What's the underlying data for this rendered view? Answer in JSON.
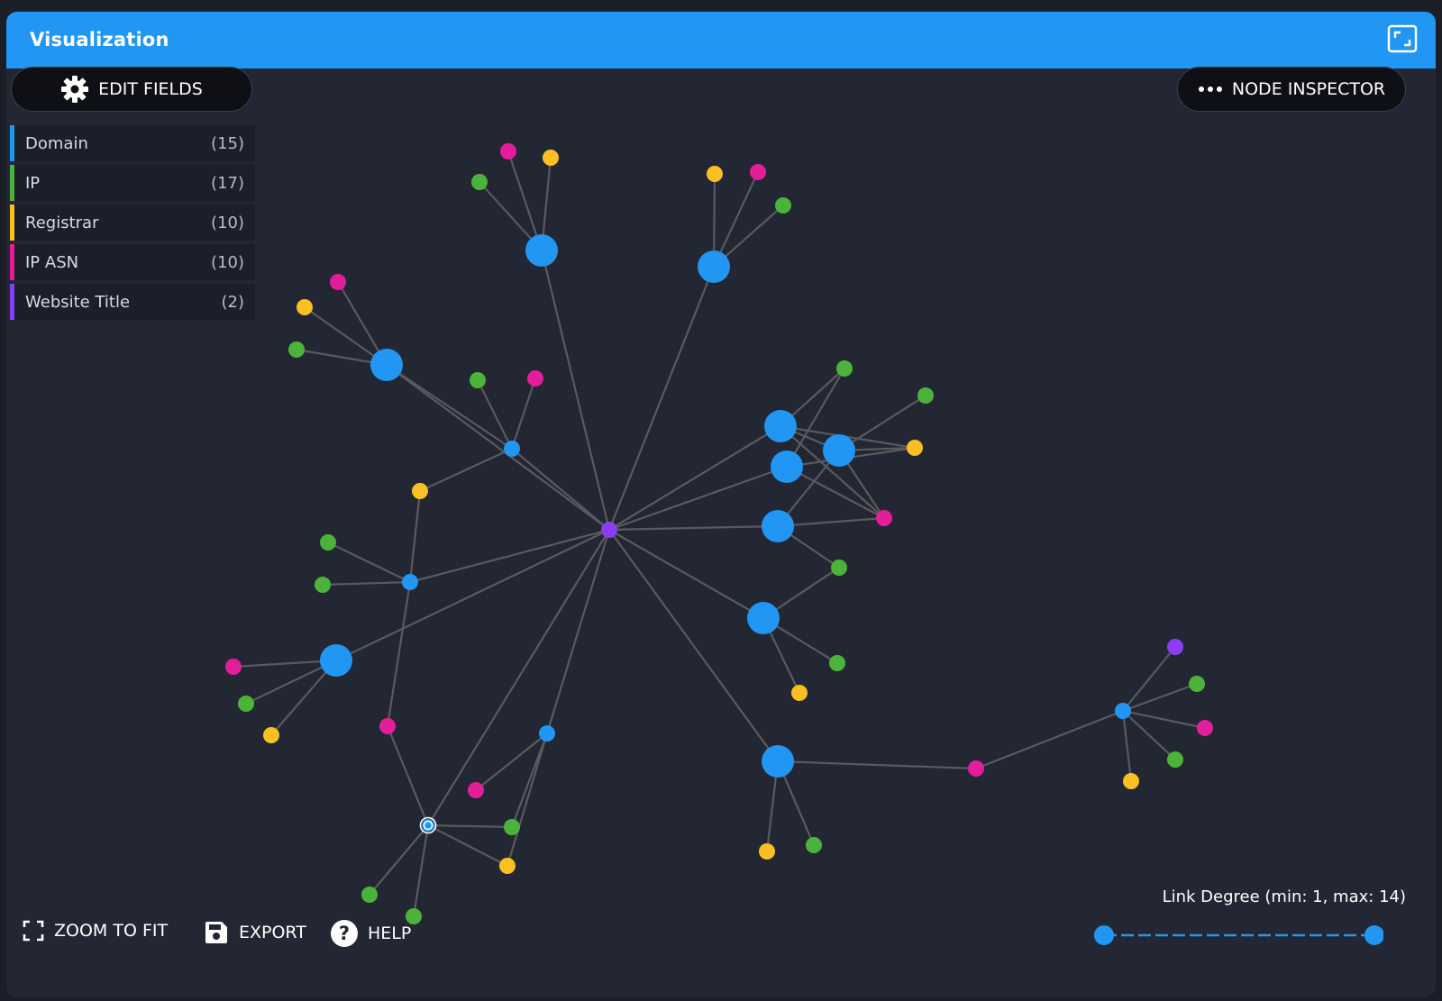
{
  "header": {
    "title": "Visualization",
    "color": "#2196f3"
  },
  "toolbar": {
    "edit_fields_label": "EDIT FIELDS",
    "node_inspector_label": "NODE INSPECTOR",
    "zoom_to_fit_label": "ZOOM TO FIT",
    "export_label": "EXPORT",
    "help_label": "HELP"
  },
  "legend": [
    {
      "label": "Domain",
      "count": "(15)",
      "color": "#2196f3"
    },
    {
      "label": "IP",
      "count": "(17)",
      "color": "#4cb33a"
    },
    {
      "label": "Registrar",
      "count": "(10)",
      "color": "#fbbf24"
    },
    {
      "label": "IP ASN",
      "count": "(10)",
      "color": "#e21e9a"
    },
    {
      "label": "Website Title",
      "count": "(2)",
      "color": "#8b3df5"
    }
  ],
  "link_degree": {
    "label": "Link Degree (min: 1, max: 14)",
    "min": 1,
    "max": 14,
    "selected_min": 1,
    "selected_max": 14
  },
  "icons": {
    "fullscreen": "fullscreen-icon",
    "settings": "gear-icon",
    "more": "more-dots-icon",
    "zoom_fit": "zoom-fit-icon",
    "export": "save-icon",
    "help": "help-icon"
  }
}
